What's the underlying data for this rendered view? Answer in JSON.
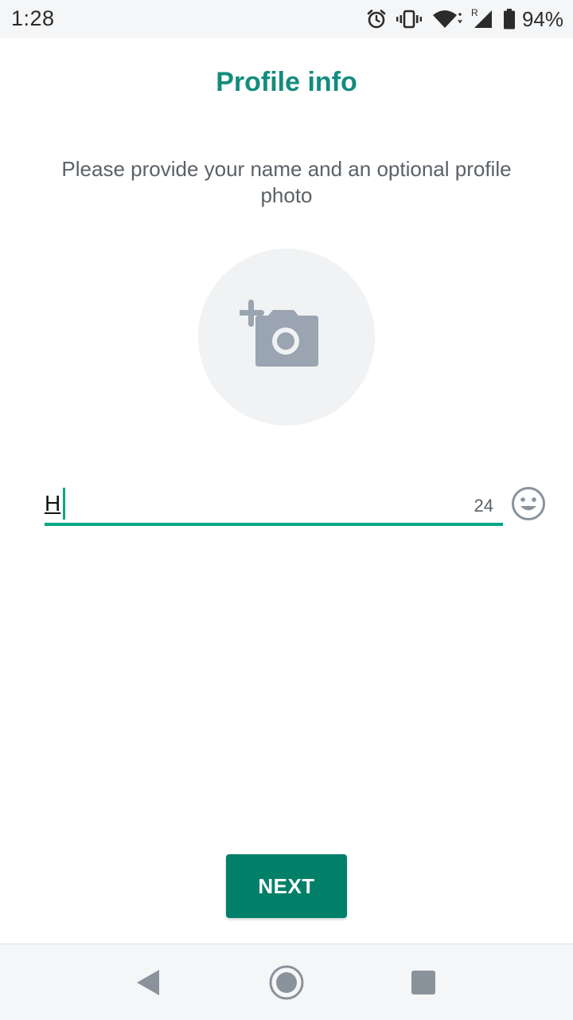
{
  "status_bar": {
    "time": "1:28",
    "battery_percent": "94%",
    "network_label": "R",
    "icons": [
      "alarm-icon",
      "vibrate-icon",
      "wifi-icon",
      "cell-signal-icon",
      "battery-icon"
    ]
  },
  "header": {
    "title": "Profile info"
  },
  "intro": {
    "text": "Please provide your name and an optional profile photo"
  },
  "profile_photo": {
    "icon": "add-camera-icon"
  },
  "name_input": {
    "value": "H",
    "remaining_chars": "24",
    "emoji_icon": "emoji-icon"
  },
  "actions": {
    "next_label": "NEXT"
  },
  "navigation": {
    "icons": [
      "back-icon",
      "home-icon",
      "recents-icon"
    ]
  },
  "colors": {
    "accent": "#128c7e",
    "button": "#008069",
    "underline": "#00a884",
    "muted_text": "#5b6168",
    "icon_gray": "#9aa5b1"
  }
}
